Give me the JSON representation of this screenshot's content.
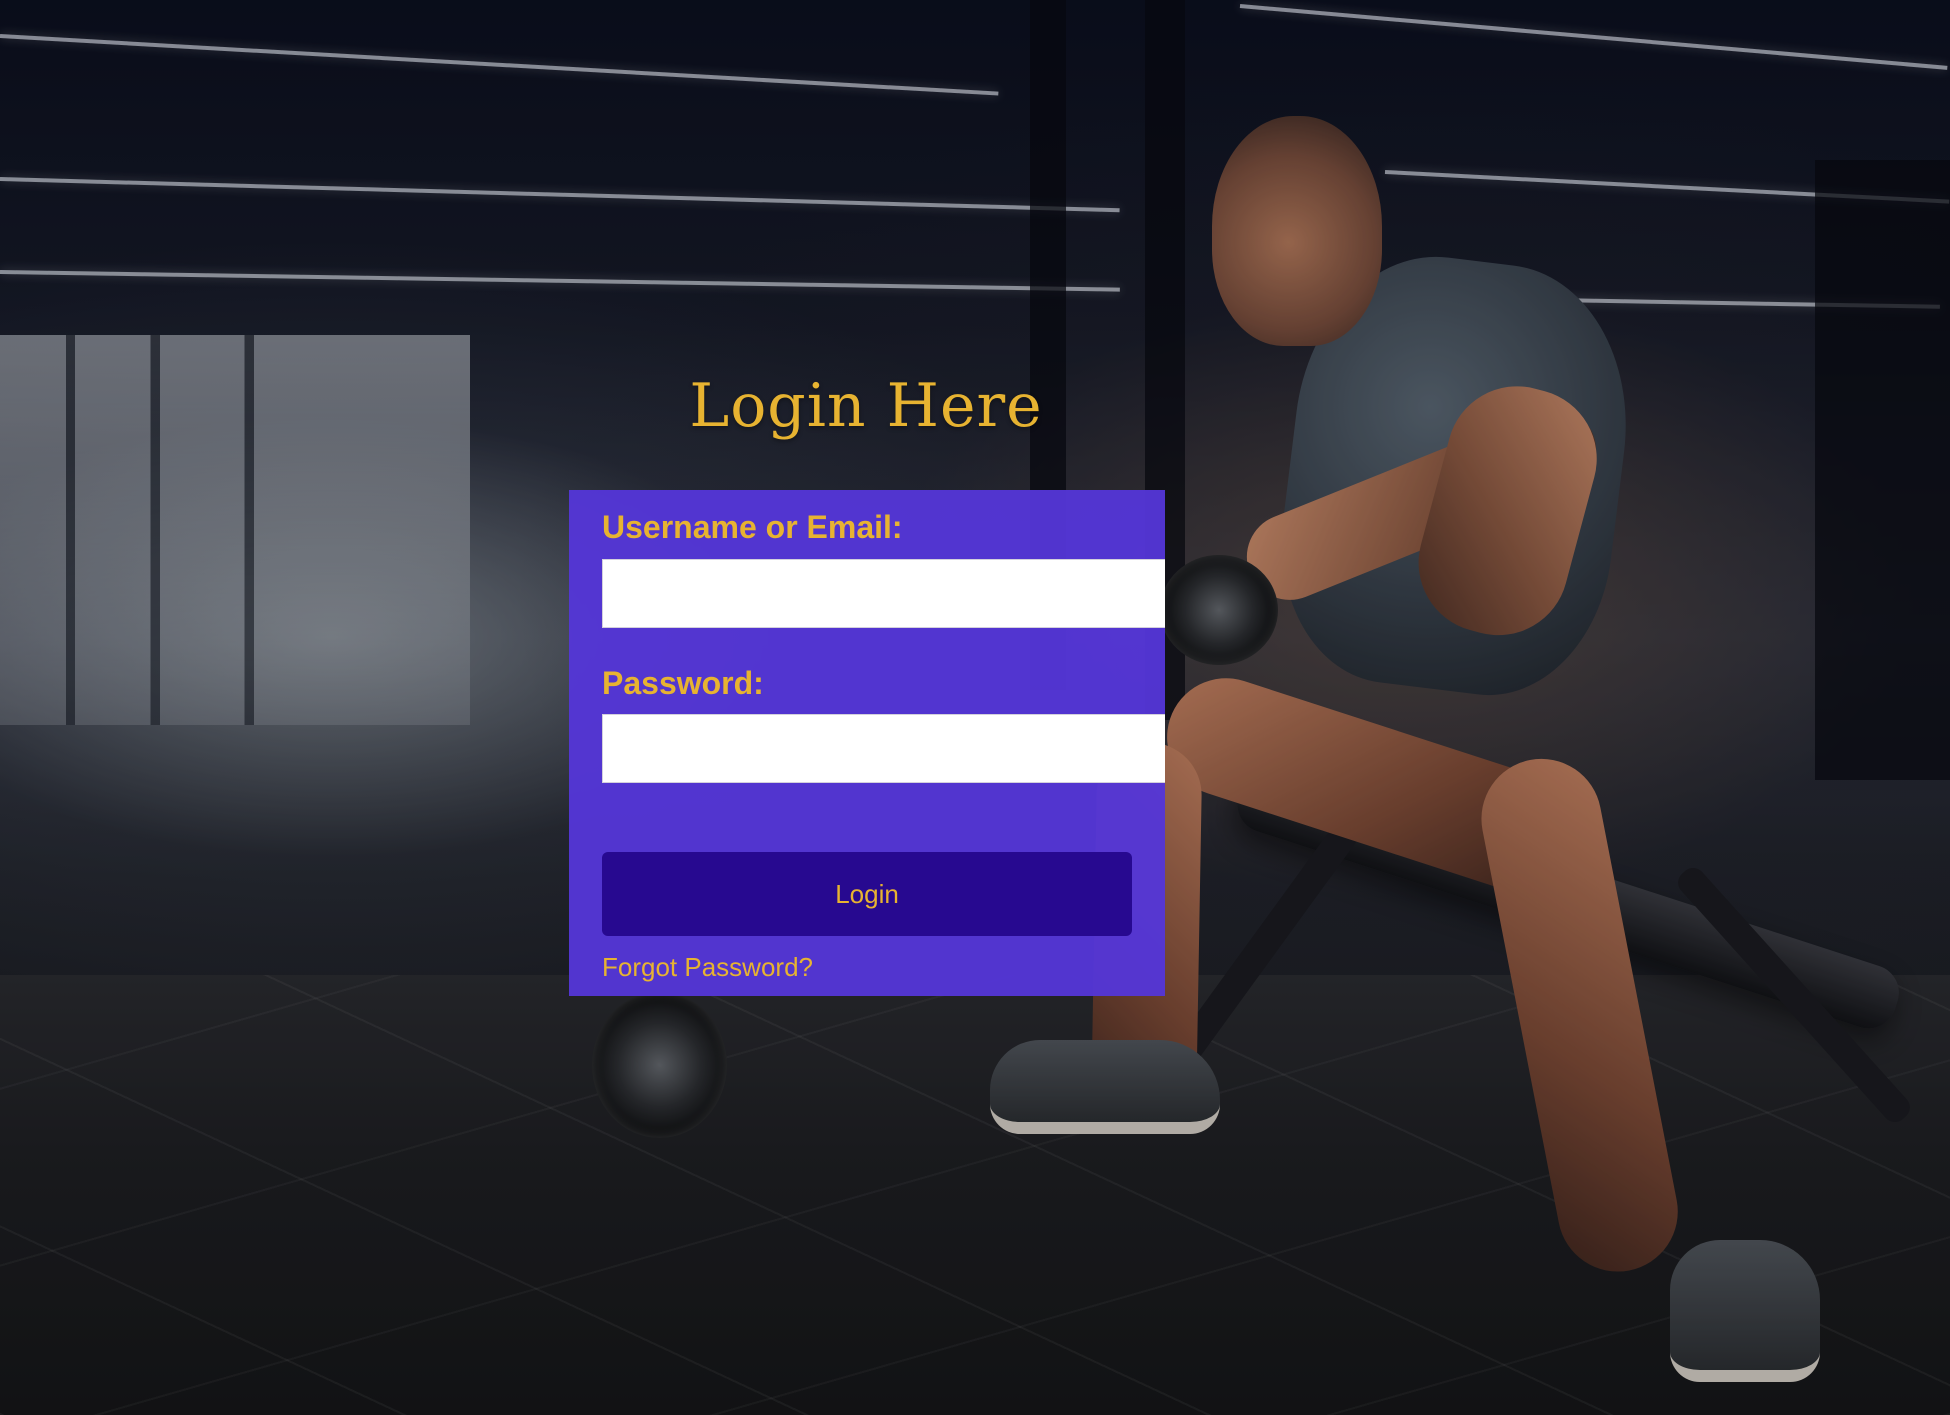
{
  "login": {
    "title": "Login Here",
    "username_label": "Username or Email:",
    "username_value": "",
    "password_label": "Password:",
    "password_value": "",
    "button_label": "Login",
    "forgot_password": "Forgot Password?"
  },
  "background": {
    "image": "gym-workout-photo"
  },
  "colors": {
    "panel": "#5436D6",
    "button": "#270990",
    "accent_text": "#E7B331",
    "input": "#FFFFFF"
  }
}
